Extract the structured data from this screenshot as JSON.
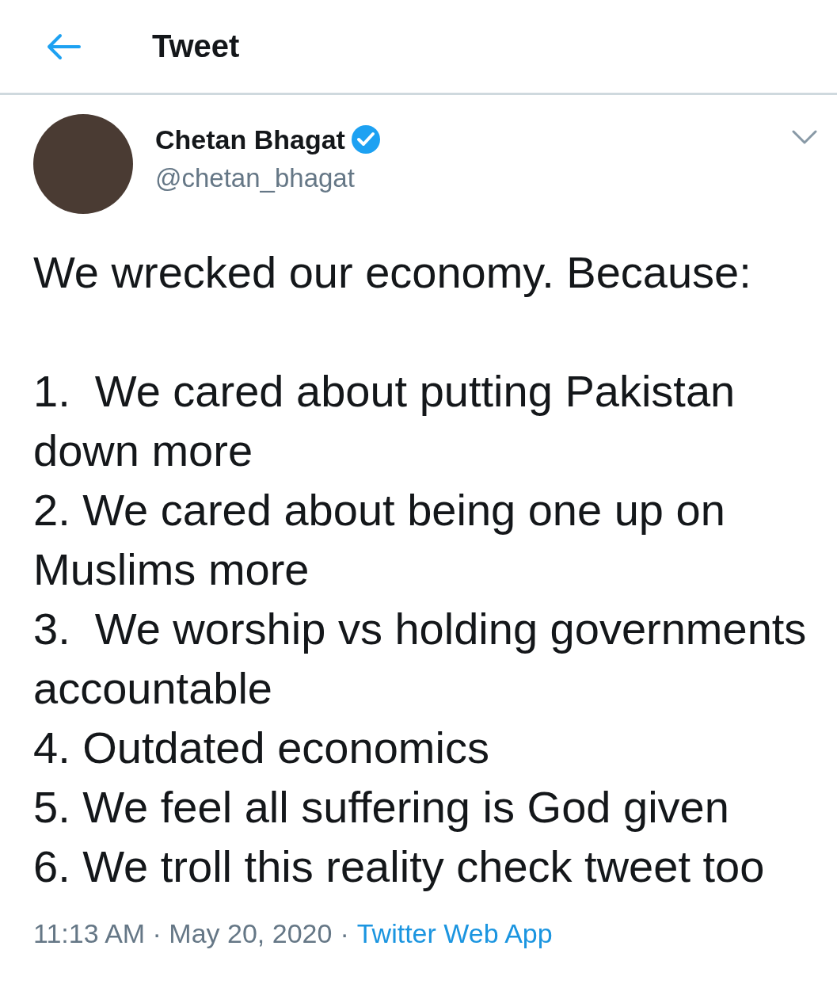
{
  "header": {
    "title": "Tweet"
  },
  "tweet": {
    "author": {
      "name": "Chetan Bhagat",
      "handle": "@chetan_bhagat",
      "verified": true
    },
    "intro": "We wrecked our economy. Because:",
    "items": [
      "1.  We cared about putting Pakistan down more",
      "2. We cared about being one up on Muslims more",
      "3.  We worship vs holding governments  accountable",
      "4. Outdated economics",
      "5. We feel all suffering is God given",
      "6. We troll this reality check tweet too"
    ],
    "timestamp": "11:13 AM · May 20, 2020",
    "separator": "·",
    "source": "Twitter Web App"
  }
}
